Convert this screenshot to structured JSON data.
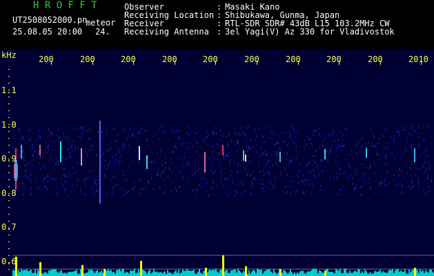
{
  "header": {
    "title": "H R O F F T",
    "filename": "UT2508052000.pn",
    "meteor_label": "meteor",
    "datetime": "25.08.05 20:00",
    "count": "24.",
    "info": [
      {
        "label": "Observer",
        "value": "Masaki Kano"
      },
      {
        "label": "Receiving Location",
        "value": "Shibukawa, Gunma, Japan"
      },
      {
        "label": "Receiver",
        "value": "RTL-SDR SDR# 43dB L15 103.2MHz CW"
      },
      {
        "label": "Receiving Antenna",
        "value": "3el Yagi(V) Az 330 for Vladivostok"
      }
    ],
    "colon": ":"
  },
  "chart_data": {
    "type": "heatmap",
    "ylabel": "kHz",
    "y_ticks": [
      "1.1",
      "1.0",
      "0.9",
      "0.8",
      "0.7",
      "0.6"
    ],
    "x_ticks": [
      "200",
      "200",
      "200",
      "200",
      "200",
      "200",
      "200",
      "200",
      "200",
      "2010"
    ],
    "signal_band_khz": [
      0.8,
      1.0
    ],
    "meteor_echo_count": "24."
  },
  "colors": {
    "background": "#000033",
    "header_bg": "#000000",
    "title": "#33cc33",
    "labels": "#ffff44",
    "bars": "#ffff00",
    "noise": "#00cccc"
  }
}
